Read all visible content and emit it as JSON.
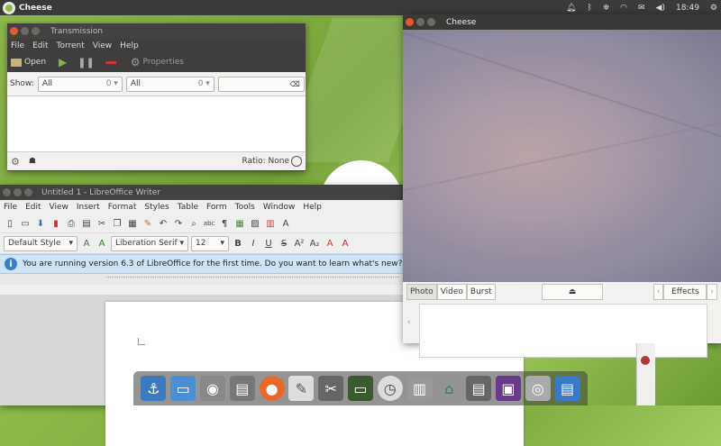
{
  "top_panel": {
    "app_name": "Cheese",
    "clock": "18:49",
    "tray_icons": [
      "notification-bell-icon",
      "bluetooth-icon",
      "flashlight-icon",
      "wifi-icon",
      "mail-icon",
      "volume-icon",
      "gear-icon"
    ]
  },
  "transmission": {
    "title": "Transmission",
    "menu": [
      "File",
      "Edit",
      "Torrent",
      "View",
      "Help"
    ],
    "toolbar": {
      "open_label": "Open",
      "properties_label": "Properties"
    },
    "filter": {
      "show_label": "Show:",
      "combo1_value": "All",
      "combo1_count": "0",
      "combo2_value": "All",
      "combo2_count": "0",
      "search_value": ""
    },
    "status": {
      "ratio": "Ratio: None"
    }
  },
  "writer": {
    "title": "Untitled 1 - LibreOffice Writer",
    "menu": [
      "File",
      "Edit",
      "View",
      "Insert",
      "Format",
      "Styles",
      "Table",
      "Form",
      "Tools",
      "Window",
      "Help"
    ],
    "format": {
      "style": "Default Style",
      "font": "Liberation Serif",
      "size": "12"
    },
    "infobar_text": "You are running version 6.3 of LibreOffice for the first time. Do you want to learn what's new?"
  },
  "cheese": {
    "title": "Cheese",
    "modes": [
      "Photo",
      "Video",
      "Burst"
    ],
    "effects_label": "Effects"
  },
  "colors": {
    "accent": "#e05b2b",
    "panel": "#3a3a38",
    "infobar": "#cfe5f7"
  }
}
